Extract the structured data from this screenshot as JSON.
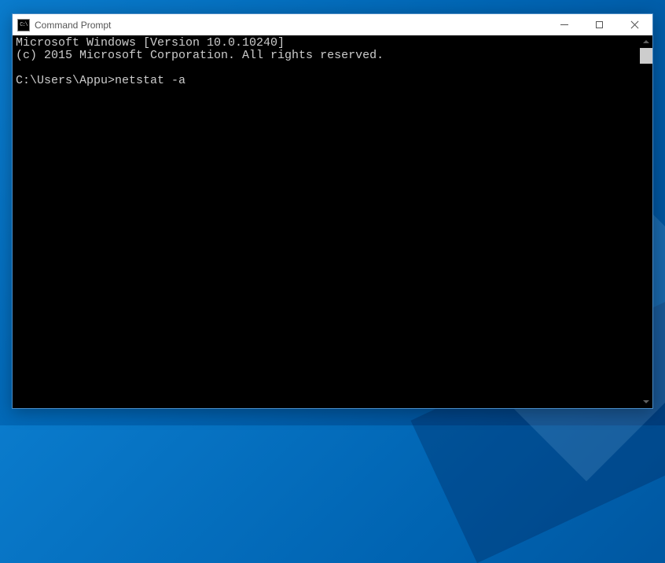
{
  "window": {
    "title": "Command Prompt"
  },
  "terminal": {
    "line1": "Microsoft Windows [Version 10.0.10240]",
    "line2": "(c) 2015 Microsoft Corporation. All rights reserved.",
    "prompt": "C:\\Users\\Appu>",
    "command": "netstat -a"
  }
}
